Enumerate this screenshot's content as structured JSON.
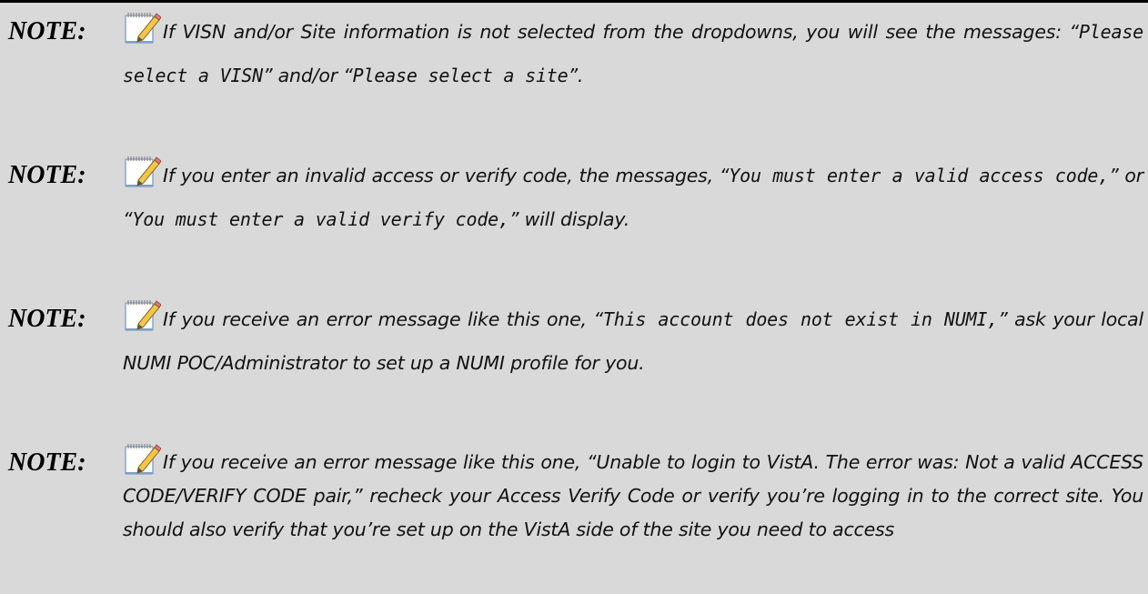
{
  "notes": [
    {
      "label": "NOTE:",
      "icon": "notepad-pencil-icon",
      "segments": [
        {
          "text": "If VISN and/or Site information is not selected from the dropdowns, you will see the messages: “",
          "mono": false
        },
        {
          "text": "Please select a VISN",
          "mono": true
        },
        {
          "text": "” and/or “",
          "mono": false
        },
        {
          "text": "Please select a site",
          "mono": true
        },
        {
          "text": "”.",
          "mono": false
        }
      ]
    },
    {
      "label": "NOTE:",
      "icon": "notepad-pencil-icon",
      "segments": [
        {
          "text": "If you enter an invalid access or verify code, the messages, “",
          "mono": false
        },
        {
          "text": "You must enter a valid access code,",
          "mono": true
        },
        {
          "text": "” or “",
          "mono": false
        },
        {
          "text": "You must enter a valid verify code,",
          "mono": true
        },
        {
          "text": "” will display.",
          "mono": false
        }
      ]
    },
    {
      "label": "NOTE:",
      "icon": "notepad-pencil-icon",
      "segments": [
        {
          "text": "If you receive an error message like this one, “",
          "mono": false
        },
        {
          "text": "This account does not exist in NUMI,",
          "mono": true
        },
        {
          "text": "” ask your local NUMI POC/Administrator to set up a NUMI profile for you.",
          "mono": false
        }
      ]
    },
    {
      "label": "NOTE:",
      "icon": "notepad-pencil-icon",
      "segments": [
        {
          "text": "If you receive an error message like this one, “Unable to login to VistA. The error was: Not a valid ACCESS CODE/VERIFY CODE pair,” recheck your Access Verify Code or verify you’re logging in to the correct site. You should also verify that you’re set up on the VistA side of the site you need to access",
          "mono": false
        }
      ]
    }
  ]
}
